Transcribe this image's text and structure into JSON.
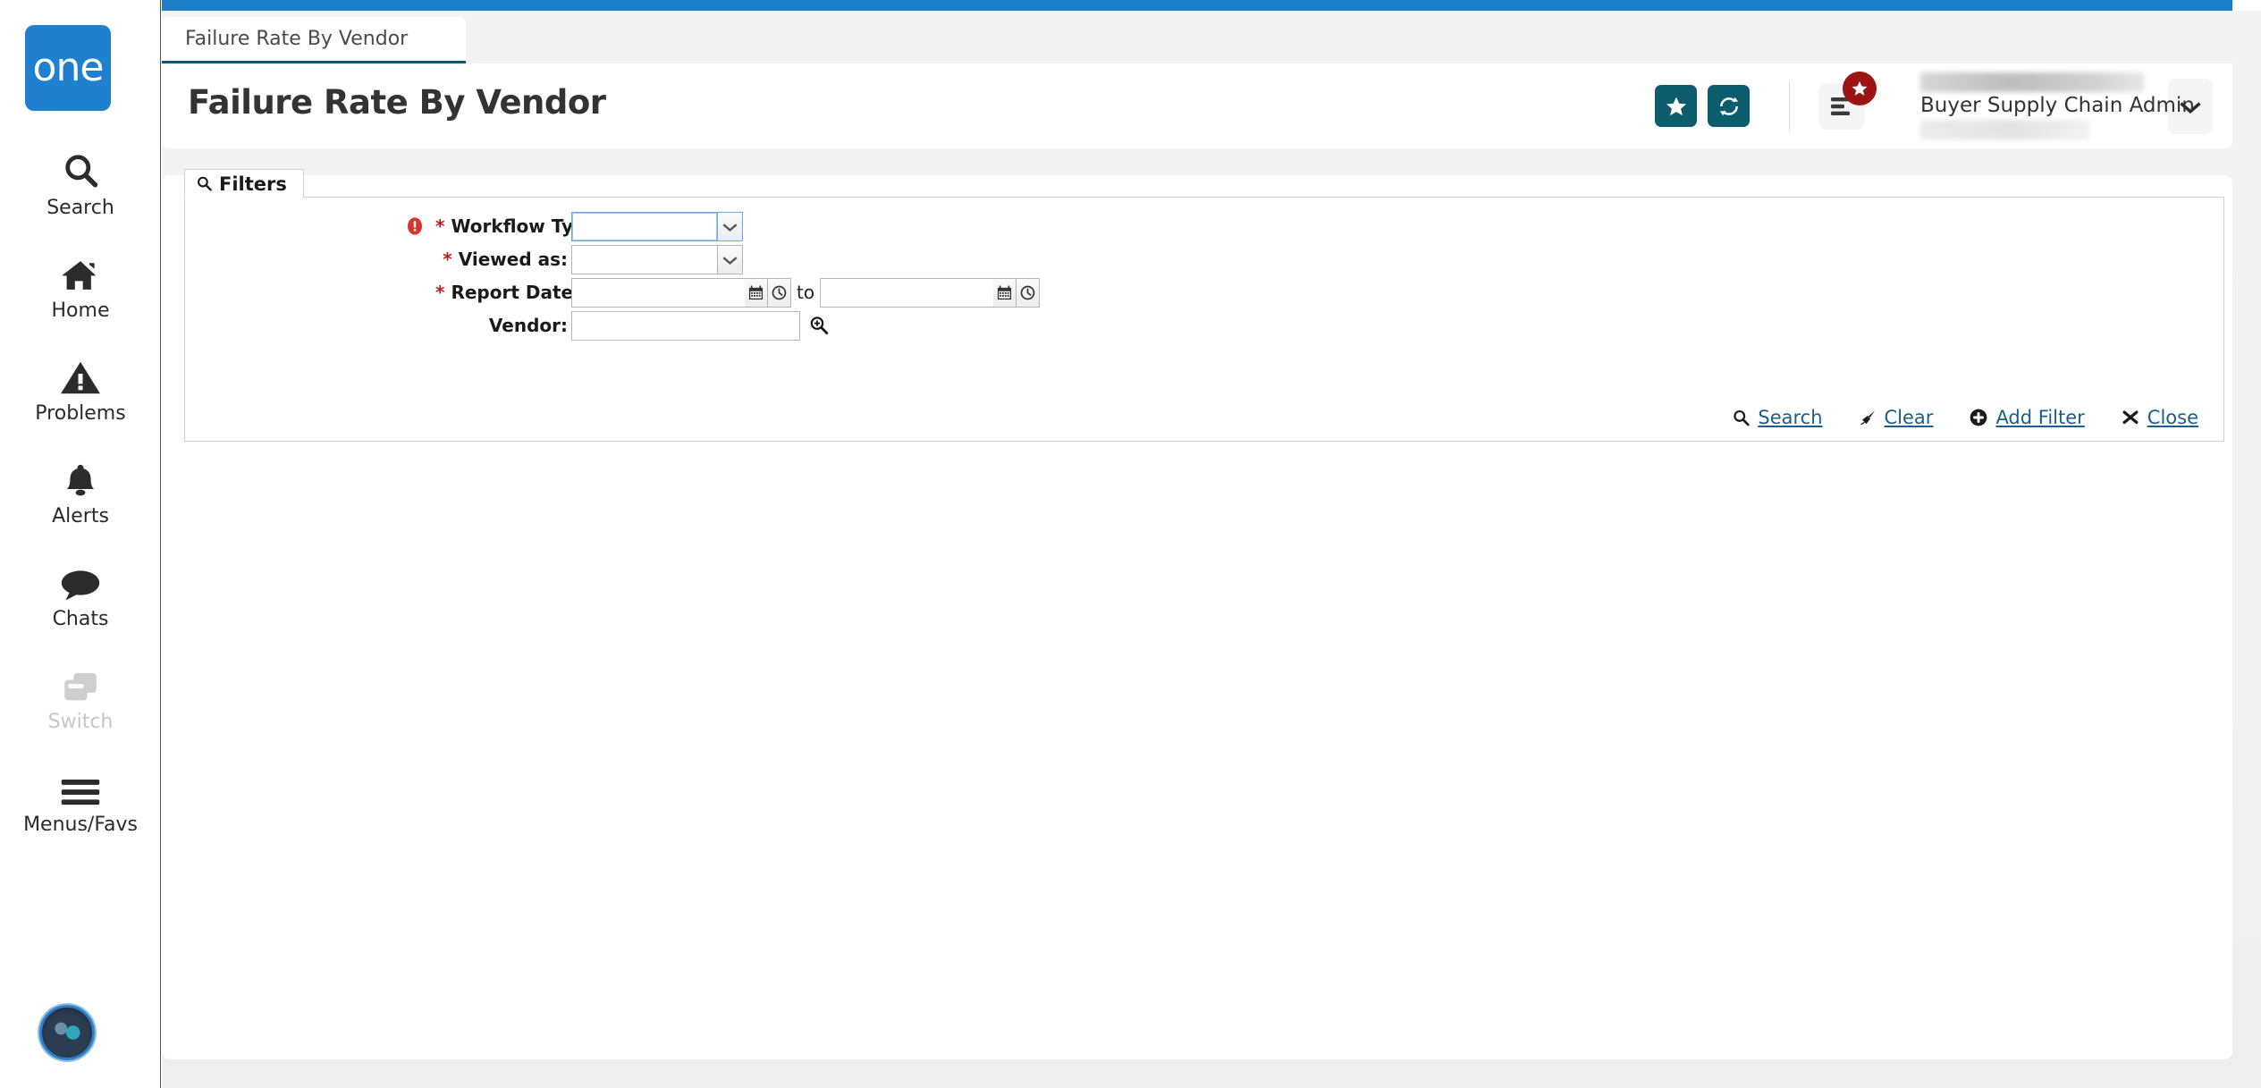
{
  "brand": {
    "logo_text": "one",
    "logo_bg": "#1e80ce",
    "accent_teal": "#0d5c6e",
    "top_bar_blue": "#1b7fc8",
    "link_blue": "#1b5e8c",
    "required_red": "#b22222",
    "badge_red": "#9b1313"
  },
  "sidebar": {
    "items": [
      {
        "label": "Search",
        "icon": "search-icon",
        "disabled": false
      },
      {
        "label": "Home",
        "icon": "home-icon",
        "disabled": false
      },
      {
        "label": "Problems",
        "icon": "warning-icon",
        "disabled": false
      },
      {
        "label": "Alerts",
        "icon": "bell-icon",
        "disabled": false
      },
      {
        "label": "Chats",
        "icon": "chat-icon",
        "disabled": false
      },
      {
        "label": "Switch",
        "icon": "switch-icon",
        "disabled": true
      },
      {
        "label": "Menus/Favs",
        "icon": "hamburger-icon",
        "disabled": false
      }
    ],
    "avatar": {
      "icon": "user-avatar",
      "label": ""
    }
  },
  "tabs": [
    {
      "label": "Failure Rate By Vendor",
      "active": true
    }
  ],
  "header": {
    "title": "Failure Rate By Vendor",
    "favorite_icon": "star-icon",
    "refresh_icon": "refresh-icon",
    "notifications_icon": "list-icon",
    "notification_badge_icon": "star-badge-icon",
    "user_name_redacted": "",
    "user_role": "Buyer Supply Chain Admin",
    "user_extra_redacted": "",
    "user_menu_icon": "chevron-down-icon"
  },
  "filters": {
    "tab_label": "Filters",
    "tab_icon": "search-icon",
    "rows": [
      {
        "id": "workflow-type",
        "label": "Workflow Type:",
        "required": true,
        "error": true,
        "error_icon": "error-icon",
        "control": "combo",
        "value": "",
        "focused": true
      },
      {
        "id": "viewed-as",
        "label": "Viewed as:",
        "required": true,
        "error": false,
        "control": "combo",
        "value": "",
        "focused": false
      },
      {
        "id": "report-date",
        "label": "Report Date:",
        "required": true,
        "error": false,
        "control": "date-range",
        "from_value": "",
        "to_value": "",
        "between_word": "to",
        "calendar_icon": "calendar-icon",
        "clock_icon": "clock-icon"
      },
      {
        "id": "vendor",
        "label": "Vendor:",
        "required": false,
        "error": false,
        "control": "lookup",
        "value": "",
        "lookup_icon": "magnifier-plus-icon"
      }
    ],
    "actions": [
      {
        "id": "search",
        "label": "Search",
        "icon": "search-icon"
      },
      {
        "id": "clear",
        "label": "Clear",
        "icon": "broom-icon"
      },
      {
        "id": "add-filter",
        "label": "Add Filter",
        "icon": "plus-circle-icon"
      },
      {
        "id": "close",
        "label": "Close",
        "icon": "close-x-icon"
      }
    ]
  }
}
